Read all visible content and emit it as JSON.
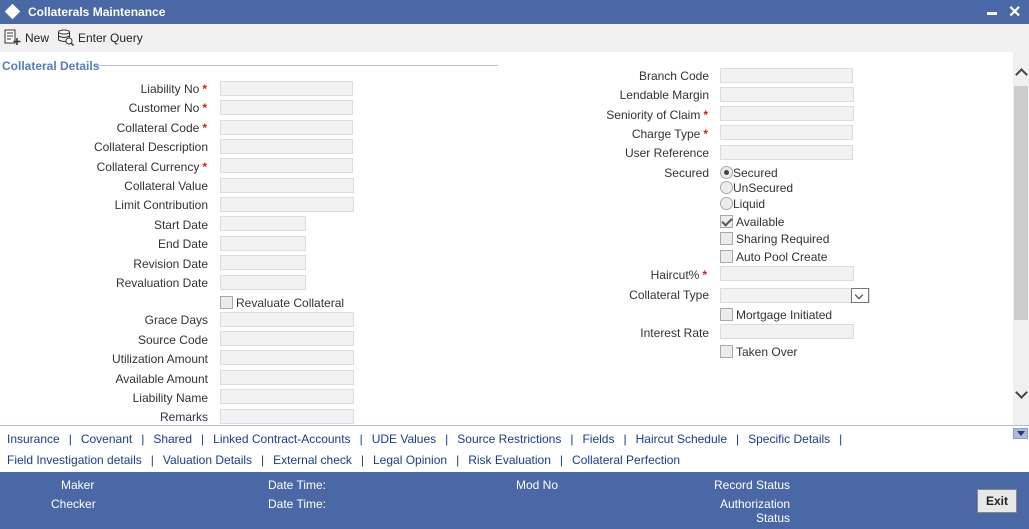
{
  "window": {
    "title": "Collaterals Maintenance",
    "minimize_icon": "minimize-icon",
    "close_icon": "close-icon"
  },
  "toolbar": {
    "new_label": "New",
    "enter_query_label": "Enter Query"
  },
  "section": {
    "title": "Collateral Details"
  },
  "left_fields": {
    "liability_no": {
      "label": "Liability No",
      "required": "*",
      "value": ""
    },
    "customer_no": {
      "label": "Customer No",
      "required": "*",
      "value": ""
    },
    "collateral_code": {
      "label": "Collateral Code",
      "required": "*",
      "value": ""
    },
    "collateral_description": {
      "label": "Collateral Description",
      "value": ""
    },
    "collateral_currency": {
      "label": "Collateral Currency",
      "required": "*",
      "value": ""
    },
    "collateral_value": {
      "label": "Collateral Value",
      "value": ""
    },
    "limit_contribution": {
      "label": "Limit Contribution",
      "value": ""
    },
    "start_date": {
      "label": "Start Date",
      "value": ""
    },
    "end_date": {
      "label": "End Date",
      "value": ""
    },
    "revision_date": {
      "label": "Revision Date",
      "value": ""
    },
    "revaluation_date": {
      "label": "Revaluation Date",
      "value": ""
    },
    "revaluate_collateral": {
      "label": "Revaluate Collateral",
      "checked": false
    },
    "grace_days": {
      "label": "Grace Days",
      "value": ""
    },
    "source_code": {
      "label": "Source Code",
      "value": ""
    },
    "utilization_amount": {
      "label": "Utilization Amount",
      "value": ""
    },
    "available_amount": {
      "label": "Available Amount",
      "value": ""
    },
    "liability_name": {
      "label": "Liability Name",
      "value": ""
    },
    "remarks": {
      "label": "Remarks",
      "value": ""
    }
  },
  "right_fields": {
    "branch_code": {
      "label": "Branch Code",
      "value": ""
    },
    "lendable_margin": {
      "label": "Lendable Margin",
      "value": ""
    },
    "seniority_of_claim": {
      "label": "Seniority of Claim",
      "required": "*",
      "value": ""
    },
    "charge_type": {
      "label": "Charge Type",
      "required": "*",
      "value": ""
    },
    "user_reference": {
      "label": "User Reference",
      "value": ""
    },
    "secured": {
      "label": "Secured",
      "options": [
        "Secured",
        "UnSecured",
        "Liquid"
      ],
      "selected": "Secured"
    },
    "available": {
      "label": "Available",
      "checked": true
    },
    "sharing_required": {
      "label": "Sharing Required",
      "checked": false
    },
    "auto_pool_create": {
      "label": "Auto Pool Create",
      "checked": false
    },
    "haircut": {
      "label": "Haircut%",
      "required": "*",
      "value": ""
    },
    "collateral_type": {
      "label": "Collateral Type",
      "value": ""
    },
    "mortgage_initiated": {
      "label": "Mortgage Initiated",
      "checked": false
    },
    "interest_rate": {
      "label": "Interest Rate",
      "value": ""
    },
    "taken_over": {
      "label": "Taken Over",
      "checked": false
    }
  },
  "links_row1": [
    "Insurance",
    "Covenant",
    "Shared",
    "Linked Contract-Accounts",
    "UDE Values",
    "Source Restrictions",
    "Fields",
    "Haircut Schedule",
    "Specific Details"
  ],
  "links_row2": [
    "Field Investigation details",
    "Valuation Details",
    "External check",
    "Legal Opinion",
    "Risk Evaluation",
    "Collateral Perfection"
  ],
  "separator": "|",
  "footer": {
    "maker": "Maker",
    "checker": "Checker",
    "date_time_1": "Date Time:",
    "date_time_2": "Date Time:",
    "mod_no": "Mod No",
    "record_status": "Record Status",
    "authorization": "Authorization",
    "status": "Status",
    "exit_label": "Exit"
  },
  "colors": {
    "title_bar": "#4a68a6",
    "section_title": "#5a7cb6",
    "link": "#1a3c8c",
    "required": "#cc2222"
  }
}
